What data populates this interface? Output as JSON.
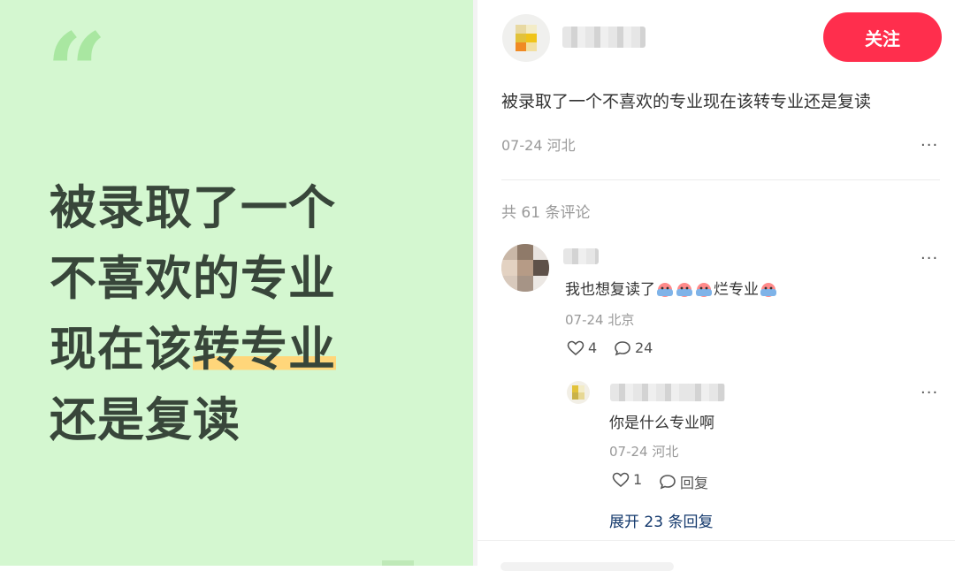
{
  "poster": {
    "quote_mark": "“",
    "lines": [
      "被录取了一个",
      "不喜欢的专业",
      "现在该",
      "还是复读"
    ],
    "line3_highlight": "转专业",
    "colors": {
      "background": "#d4f7d0",
      "text": "#38463a",
      "highlight": "#ffd67a",
      "quote": "#a9e7a1"
    }
  },
  "post": {
    "follow_label": "关注",
    "title": "被录取了一个不喜欢的专业现在该转专业还是复读",
    "date": "07-24",
    "location": "河北",
    "more_icon": "ellipsis-icon",
    "comment_count_label": "共 61 条评论"
  },
  "comments": [
    {
      "text_before": "我也想复读了",
      "text_after": "烂专业",
      "emoji_icon": "sob-face-icon",
      "date": "07-24",
      "location": "北京",
      "likes": "4",
      "replies": "24",
      "reply": {
        "text": "你是什么专业啊",
        "date": "07-24",
        "location": "河北",
        "likes": "1",
        "reply_label": "回复"
      },
      "expand_label": "展开 23 条回复"
    }
  ],
  "colors": {
    "accent": "#ff2e4d",
    "link": "#13386c",
    "muted": "#999999"
  }
}
